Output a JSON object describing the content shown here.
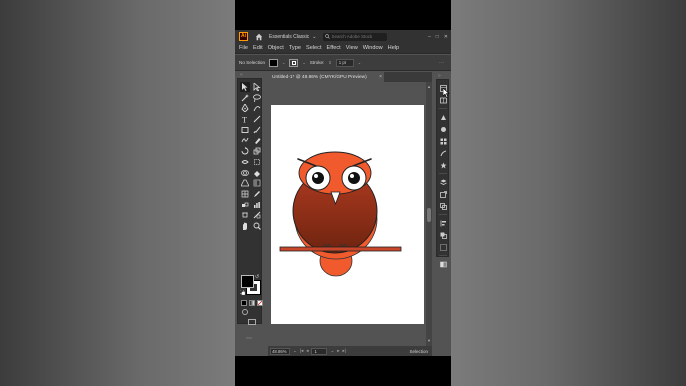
{
  "app": {
    "logo_text": "Ai",
    "workspace": "Essentials Classic",
    "search_placeholder": "Search Adobe Stock"
  },
  "menu": [
    "File",
    "Edit",
    "Object",
    "Type",
    "Select",
    "Effect",
    "View",
    "Window",
    "Help"
  ],
  "control_bar": {
    "selection_status": "No Selection",
    "stroke_label": "Stroke:",
    "stroke_value": "1 pt"
  },
  "document": {
    "tab_title": "Untitled-1* @ 48.86% (CMYK/GPU Preview)",
    "close": "×"
  },
  "status_bar": {
    "zoom": "48.86%",
    "page": "1",
    "tool_status": "Selection"
  },
  "colors": {
    "owl_body_top": "#b03a20",
    "owl_body_bottom": "#6e2410",
    "owl_tail": "#f05a2c",
    "branch": "#c8472b",
    "beak": "#ffffff",
    "accent": "#ff9a00"
  },
  "tools": [
    "selection-tool",
    "direct-selection-tool",
    "magic-wand-tool",
    "lasso-tool",
    "pen-tool",
    "curvature-tool",
    "type-tool",
    "line-segment-tool",
    "rectangle-tool",
    "paintbrush-tool",
    "shaper-tool",
    "eraser-tool",
    "rotate-tool",
    "scale-tool",
    "width-tool",
    "free-transform-tool",
    "shape-builder-tool",
    "live-paint-bucket-tool",
    "perspective-grid-tool",
    "gradient-tool",
    "mesh-tool",
    "eyedropper-tool",
    "blend-tool",
    "column-graph-tool",
    "artboard-tool",
    "slice-tool",
    "hand-tool",
    "zoom-tool"
  ],
  "panels": [
    "properties-panel",
    "libraries-panel",
    "color-panel",
    "color-guide-panel",
    "swatches-panel",
    "brushes-panel",
    "symbols-panel",
    "layers-panel",
    "asset-export-panel",
    "artboards-panel",
    "align-panel",
    "pathfinder-panel",
    "transform-panel",
    "transparency-panel"
  ]
}
